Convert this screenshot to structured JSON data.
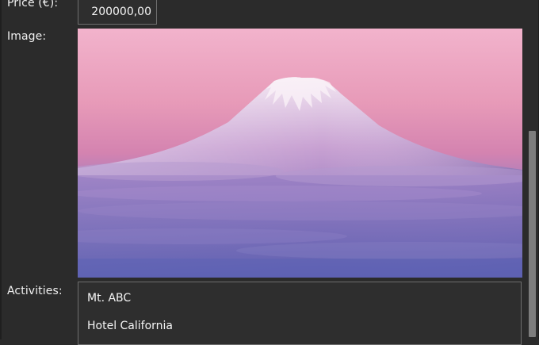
{
  "form": {
    "price_label": "Price (€):",
    "price_value": "200000,00",
    "image_label": "Image:",
    "image_alt": "Snow-capped volcanic mountain above clouds at pink-purple dusk",
    "activities_label": "Activities:",
    "activities": [
      "Mt. ABC",
      "Hotel California"
    ]
  }
}
